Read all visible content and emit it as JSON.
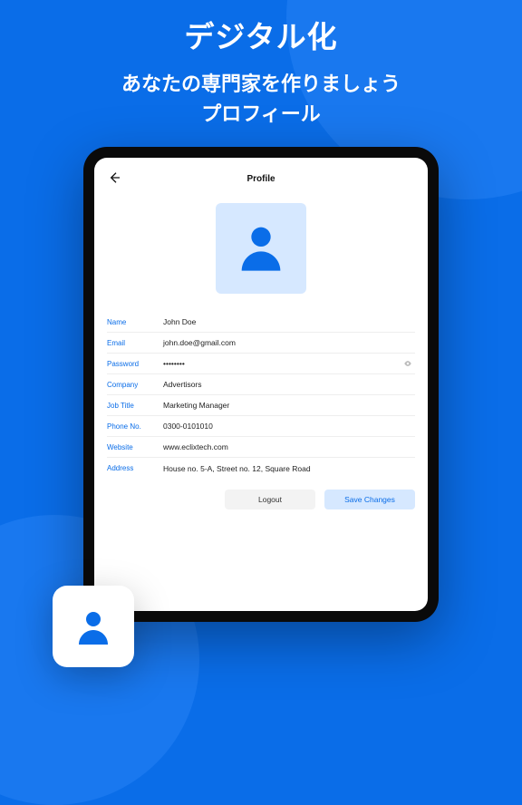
{
  "heading": "デジタル化",
  "subheading1": "あなたの専門家を作りましょう",
  "subheading2": "プロフィール",
  "screen": {
    "title": "Profile",
    "fields": {
      "name": {
        "label": "Name",
        "value": "John Doe"
      },
      "email": {
        "label": "Email",
        "value": "john.doe@gmail.com"
      },
      "pass": {
        "label": "Password",
        "value": "••••••••"
      },
      "company": {
        "label": "Company",
        "value": "Advertisors"
      },
      "job": {
        "label": "Job Title",
        "value": "Marketing Manager"
      },
      "phone": {
        "label": "Phone No.",
        "value": "0300-0101010"
      },
      "web": {
        "label": "Website",
        "value": "www.eclixtech.com"
      },
      "addr": {
        "label": "Address",
        "value": "House no. 5-A, Street no. 12, Square Road"
      }
    },
    "buttons": {
      "logout": "Logout",
      "save": "Save Changes"
    }
  }
}
